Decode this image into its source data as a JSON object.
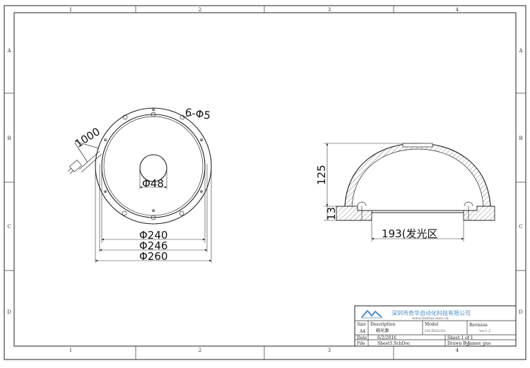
{
  "zones": {
    "columns": [
      "1",
      "2",
      "3",
      "4"
    ],
    "rows": [
      "A",
      "B",
      "C",
      "D"
    ]
  },
  "front_view": {
    "hole_callout": "6-Φ5",
    "cable_length": "1000",
    "d_inner": "Φ48",
    "d_240": "Φ240",
    "d_246": "Φ246",
    "d_260": "Φ260"
  },
  "side_view": {
    "height": "125",
    "base_height": "13",
    "width_note": "193(发光区"
  },
  "title_block": {
    "company_name": "深圳市奇华自动化科技有限公司",
    "company_url": "www.fenhua-auto.cn",
    "size_label": "Size",
    "size_value": "A4",
    "description_label": "Description",
    "description_value": "碗光源",
    "model_label": "Model",
    "model_value": "FH-BS0250",
    "revision_label": "Revision",
    "revision_value": "Ver1.2",
    "date_label": "Date",
    "date_value": "6/2/2016",
    "sheet_label": "Sheet 1 of 1",
    "file_label": "File",
    "file_value": "Sheet1.SchDoc",
    "drawn_label": "Drawn By:",
    "drawn_value": "James_guo"
  },
  "colors": {
    "logo": "#4a8cc8",
    "line": "#222222"
  }
}
